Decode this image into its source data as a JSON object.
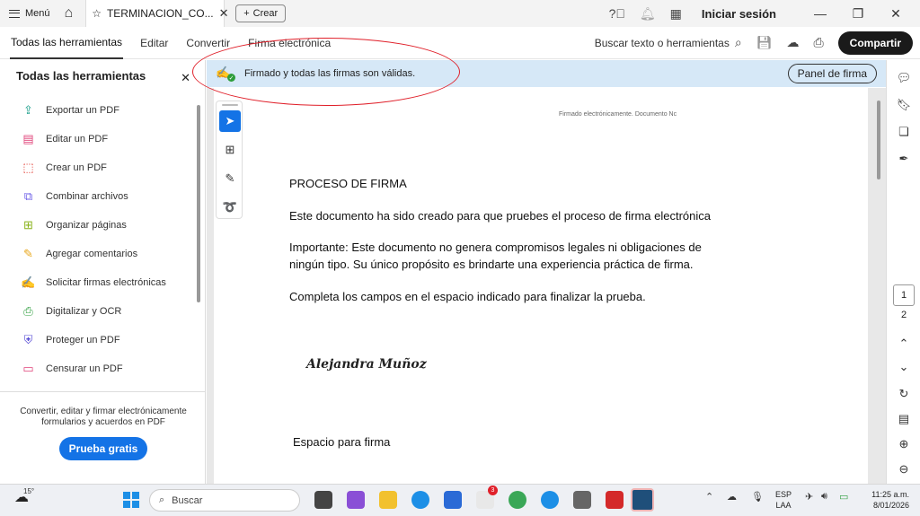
{
  "titlebar": {
    "menu_label": "Menú",
    "tab_title": "TERMINACION_CO...",
    "new_tab_label": "Crear",
    "signin_label": "Iniciar sesión"
  },
  "menubar": {
    "items": [
      "Todas las herramientas",
      "Editar",
      "Convertir",
      "Firma electrónica"
    ],
    "search_label": "Buscar texto o herramientas",
    "share_label": "Compartir"
  },
  "leftpanel": {
    "title": "Todas las herramientas",
    "tools": [
      {
        "label": "Exportar un PDF",
        "icon": "export-pdf-icon",
        "color": "#1a9e8a"
      },
      {
        "label": "Editar un PDF",
        "icon": "edit-pdf-icon",
        "color": "#e0447a"
      },
      {
        "label": "Crear un PDF",
        "icon": "create-pdf-icon",
        "color": "#e0342a"
      },
      {
        "label": "Combinar archivos",
        "icon": "combine-files-icon",
        "color": "#6b5ce7"
      },
      {
        "label": "Organizar páginas",
        "icon": "organize-pages-icon",
        "color": "#8ab31c"
      },
      {
        "label": "Agregar comentarios",
        "icon": "comment-icon",
        "color": "#e8a71c"
      },
      {
        "label": "Solicitar firmas electrónicas",
        "icon": "request-signatures-icon",
        "color": "#b03ab0"
      },
      {
        "label": "Digitalizar y OCR",
        "icon": "scan-ocr-icon",
        "color": "#2e9e3e"
      },
      {
        "label": "Proteger un PDF",
        "icon": "protect-pdf-icon",
        "color": "#5a4fd6"
      },
      {
        "label": "Censurar un PDF",
        "icon": "redact-pdf-icon",
        "color": "#e0447a"
      }
    ],
    "promo_text": "Convertir, editar y firmar electrónicamente formularios y acuerdos en PDF",
    "trial_label": "Prueba gratis"
  },
  "signature_bar": {
    "status_text": "Firmado y todas las firmas son válidas.",
    "panel_button": "Panel de firma"
  },
  "document": {
    "header_text": "Firmado electrónicamente. Documento Nc",
    "title": "PROCESO DE FIRMA",
    "para1": "Este documento ha sido creado para que pruebes el proceso de firma electrónica",
    "para2": "Importante: Este documento no genera compromisos legales ni obligaciones de ningún tipo. Su único propósito es brindarte una experiencia práctica de firma.",
    "para3": "Completa los campos en el espacio indicado para finalizar la prueba.",
    "signature_name": "Alejandra Muñoz",
    "signature_space": "Espacio para firma"
  },
  "pages": {
    "current": "1",
    "next": "2"
  },
  "taskbar": {
    "temperature": "15°",
    "search_placeholder": "Buscar",
    "badge_count": "3",
    "language": "ESP",
    "layout": "LAA",
    "time": "11:25 a.m.",
    "date": "8/01/2026"
  },
  "colors": {
    "accent": "#1473e6",
    "banner": "#d6e8f7",
    "annotation": "#e0202a"
  }
}
